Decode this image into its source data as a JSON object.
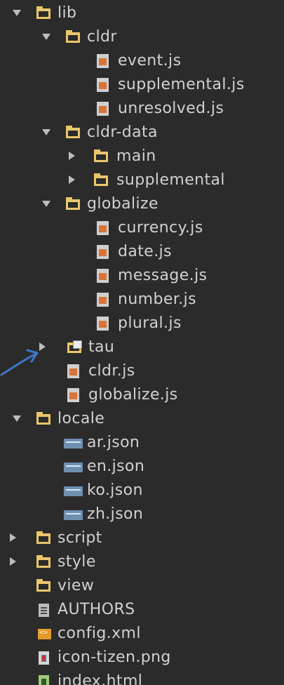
{
  "tree": {
    "lib": "lib",
    "cldr": "cldr",
    "event_js": "event.js",
    "supplemental_js": "supplemental.js",
    "unresolved_js": "unresolved.js",
    "cldr_data": "cldr-data",
    "main": "main",
    "supplemental": "supplemental",
    "globalize": "globalize",
    "currency_js": "currency.js",
    "date_js": "date.js",
    "message_js": "message.js",
    "number_js": "number.js",
    "plural_js": "plural.js",
    "tau": "tau",
    "cldr_js": "cldr.js",
    "globalize_js": "globalize.js",
    "locale": "locale",
    "ar_json": "ar.json",
    "en_json": "en.json",
    "ko_json": "ko.json",
    "zh_json": "zh.json",
    "script": "script",
    "style": "style",
    "view": "view",
    "authors": "AUTHORS",
    "config_xml": "config.xml",
    "icon_tizen_png": "icon-tizen.png",
    "index_html": "index.html"
  },
  "colors": {
    "background": "#2b2b2b",
    "folder": "#e8c66a",
    "text": "#d1d1d1",
    "arrow": "#3f76c6"
  }
}
